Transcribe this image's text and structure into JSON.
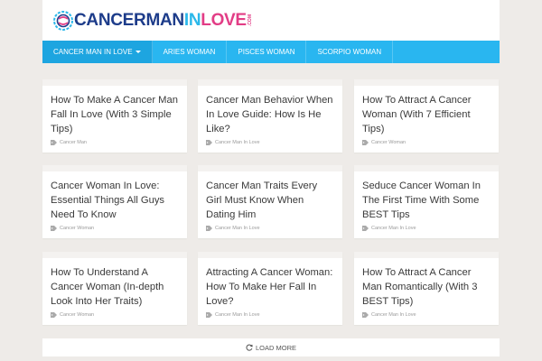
{
  "logo": {
    "part1": "CANCER",
    "part2": "MAN",
    "part3": "IN",
    "part4": "LOVE",
    "dotcom": ".COM"
  },
  "nav": {
    "items": [
      {
        "label": "CANCER MAN IN LOVE",
        "active": true,
        "has_dropdown": true
      },
      {
        "label": "ARIES WOMAN"
      },
      {
        "label": "PISCES WOMAN"
      },
      {
        "label": "SCORPIO WOMAN"
      }
    ]
  },
  "posts": [
    {
      "title": "How To Make A Cancer Man Fall In Love (With 3 Simple Tips)",
      "category": "Cancer Man"
    },
    {
      "title": "Cancer Man Behavior When In Love Guide: How Is He Like?",
      "category": "Cancer Man In Love"
    },
    {
      "title": "How To Attract A Cancer Woman (With 7 Efficient Tips)",
      "category": "Cancer Woman"
    },
    {
      "title": "Cancer Woman In Love: Essential Things All Guys Need To Know",
      "category": "Cancer Woman"
    },
    {
      "title": "Cancer Man Traits Every Girl Must Know When Dating Him",
      "category": "Cancer Man In Love"
    },
    {
      "title": "Seduce Cancer Woman In The First Time With Some BEST Tips",
      "category": "Cancer Man In Love"
    },
    {
      "title": "How To Understand A Cancer Woman (In-depth Look Into Her Traits)",
      "category": "Cancer Woman"
    },
    {
      "title": "Attracting A Cancer Woman: How To Make Her Fall In Love?",
      "category": "Cancer Man In Love"
    },
    {
      "title": "How To Attract A Cancer Man Romantically (With 3 BEST Tips)",
      "category": "Cancer Man In Love"
    }
  ],
  "load_more": {
    "label": "LOAD MORE",
    "icon": "refresh-icon"
  },
  "colors": {
    "nav_bg": "#29b6f0",
    "logo_navy": "#1d3c8a",
    "logo_blue": "#2bb8ea",
    "logo_pink": "#e23d86",
    "page_bg": "#eeebe8"
  }
}
